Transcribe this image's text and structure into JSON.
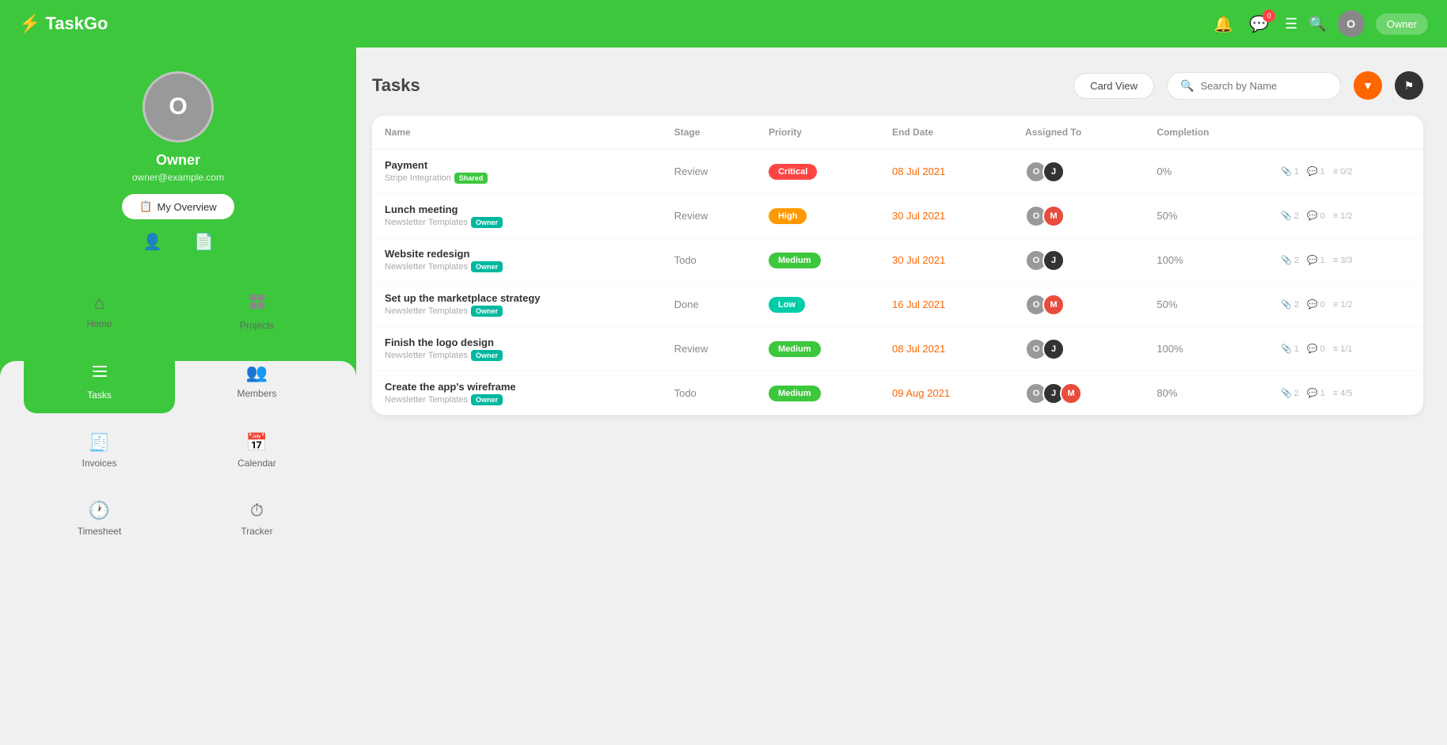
{
  "app": {
    "name": "TaskGo",
    "logo_bolt": "⚡"
  },
  "navbar": {
    "notification_count": "0",
    "user_initial": "O",
    "user_btn_label": "Owner",
    "hamburger_icon": "☰",
    "search_icon": "🔍"
  },
  "sidebar": {
    "profile": {
      "initial": "O",
      "name": "Owner",
      "email": "owner@example.com",
      "overview_btn": "My Overview"
    },
    "nav_items": [
      {
        "id": "home",
        "label": "Home",
        "icon": "⌂",
        "active": false
      },
      {
        "id": "projects",
        "label": "Projects",
        "icon": "⎇",
        "active": false
      },
      {
        "id": "tasks",
        "label": "Tasks",
        "icon": "≡",
        "active": true
      },
      {
        "id": "members",
        "label": "Members",
        "icon": "👥",
        "active": false
      },
      {
        "id": "invoices",
        "label": "Invoices",
        "icon": "📋",
        "active": false
      },
      {
        "id": "calendar",
        "label": "Calendar",
        "icon": "📅",
        "active": false
      },
      {
        "id": "timesheet",
        "label": "Timesheet",
        "icon": "🕐",
        "active": false
      },
      {
        "id": "tracker",
        "label": "Tracker",
        "icon": "⏱",
        "active": false
      }
    ]
  },
  "tasks_page": {
    "title": "Tasks",
    "card_view_btn": "Card View",
    "search_placeholder": "Search by Name",
    "columns": [
      "Name",
      "Stage",
      "Priority",
      "End Date",
      "Assigned To",
      "Completion"
    ],
    "tasks": [
      {
        "name": "Payment",
        "project": "Stripe Integration",
        "project_badge": "Shared",
        "project_badge_type": "shared",
        "stage": "Review",
        "priority": "Critical",
        "priority_type": "critical",
        "end_date": "08 Jul 2021",
        "assignees": [
          {
            "initial": "O",
            "type": "gray"
          },
          {
            "initial": "J",
            "type": "dark"
          }
        ],
        "completion": "0%",
        "attachments": "1",
        "comments": "1",
        "checklist": "0/2"
      },
      {
        "name": "Lunch meeting",
        "project": "Newsletter Templates",
        "project_badge": "Owner",
        "project_badge_type": "owner",
        "stage": "Review",
        "priority": "High",
        "priority_type": "high",
        "end_date": "30 Jul 2021",
        "assignees": [
          {
            "initial": "O",
            "type": "gray"
          },
          {
            "initial": "M",
            "type": "red"
          }
        ],
        "completion": "50%",
        "attachments": "2",
        "comments": "0",
        "checklist": "1/2"
      },
      {
        "name": "Website redesign",
        "project": "Newsletter Templates",
        "project_badge": "Owner",
        "project_badge_type": "owner",
        "stage": "Todo",
        "priority": "Medium",
        "priority_type": "medium",
        "end_date": "30 Jul 2021",
        "assignees": [
          {
            "initial": "O",
            "type": "gray"
          },
          {
            "initial": "J",
            "type": "dark"
          }
        ],
        "completion": "100%",
        "attachments": "2",
        "comments": "1",
        "checklist": "3/3"
      },
      {
        "name": "Set up the marketplace strategy",
        "project": "Newsletter Templates",
        "project_badge": "Owner",
        "project_badge_type": "owner",
        "stage": "Done",
        "priority": "Low",
        "priority_type": "low",
        "end_date": "16 Jul 2021",
        "assignees": [
          {
            "initial": "O",
            "type": "gray"
          },
          {
            "initial": "M",
            "type": "red"
          }
        ],
        "completion": "50%",
        "attachments": "2",
        "comments": "0",
        "checklist": "1/2"
      },
      {
        "name": "Finish the logo design",
        "project": "Newsletter Templates",
        "project_badge": "Owner",
        "project_badge_type": "owner",
        "stage": "Review",
        "priority": "Medium",
        "priority_type": "medium",
        "end_date": "08 Jul 2021",
        "assignees": [
          {
            "initial": "O",
            "type": "gray"
          },
          {
            "initial": "J",
            "type": "dark"
          }
        ],
        "completion": "100%",
        "attachments": "1",
        "comments": "0",
        "checklist": "1/1"
      },
      {
        "name": "Create the app's wireframe",
        "project": "Newsletter Templates",
        "project_badge": "Owner",
        "project_badge_type": "owner",
        "stage": "Todo",
        "priority": "Medium",
        "priority_type": "medium",
        "end_date": "09 Aug 2021",
        "assignees": [
          {
            "initial": "O",
            "type": "gray"
          },
          {
            "initial": "J",
            "type": "dark"
          },
          {
            "initial": "M",
            "type": "red"
          }
        ],
        "completion": "80%",
        "attachments": "2",
        "comments": "1",
        "checklist": "4/5"
      }
    ]
  }
}
